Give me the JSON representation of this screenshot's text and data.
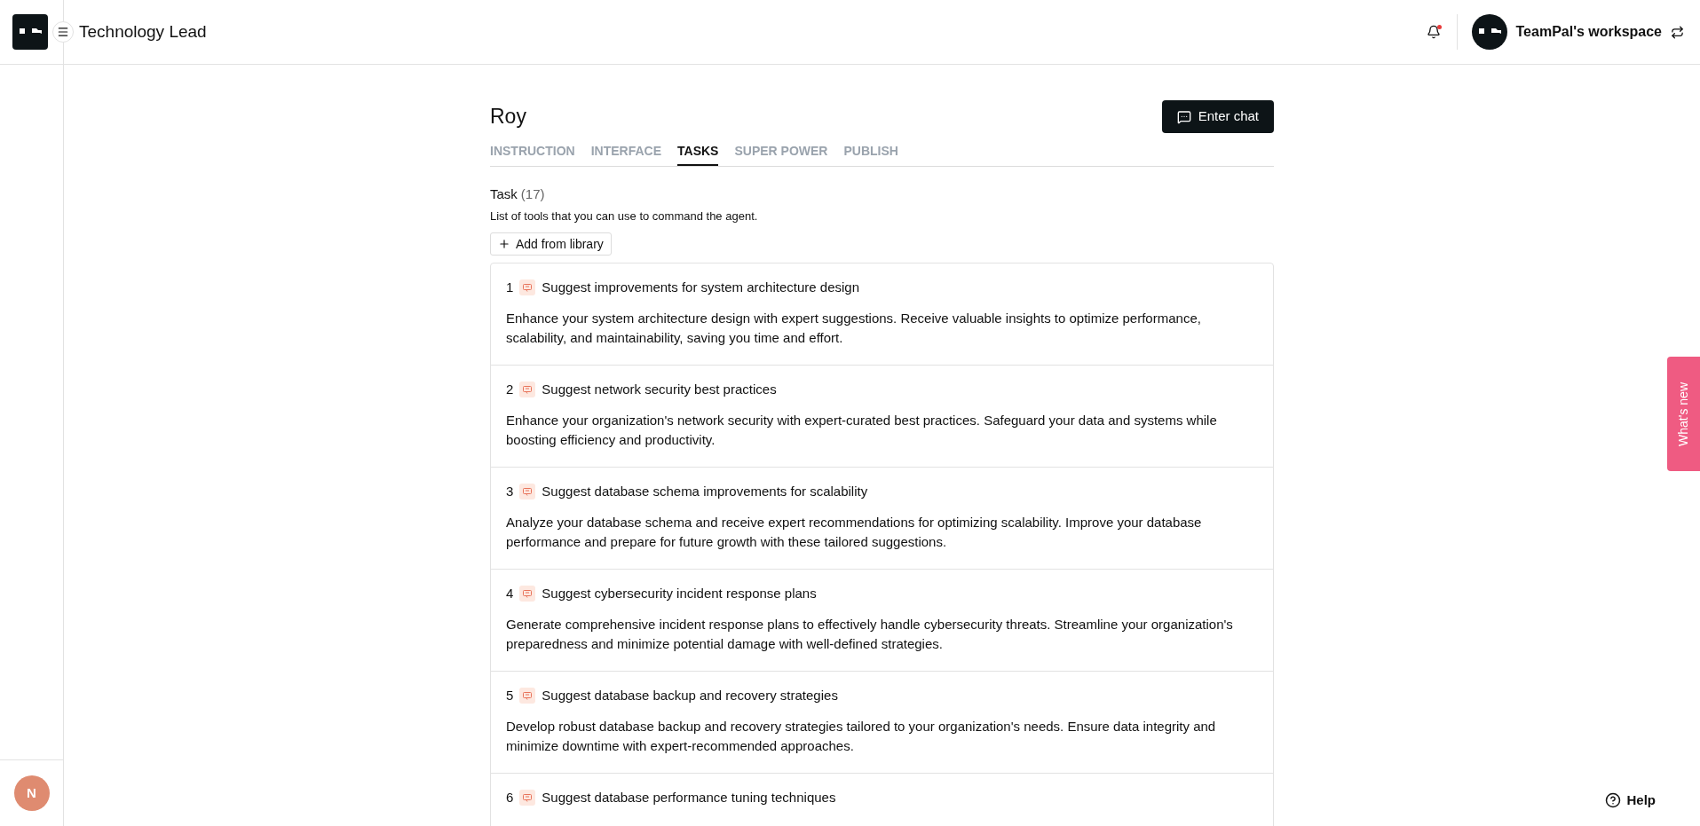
{
  "header": {
    "title": "Technology Lead",
    "workspace": "TeamPal's workspace",
    "notification_unread": true
  },
  "user_avatar": {
    "initial": "N"
  },
  "agent": {
    "name": "Roy",
    "enter_chat": "Enter chat"
  },
  "tabs": [
    {
      "label": "INSTRUCTION",
      "selected": false
    },
    {
      "label": "INTERFACE",
      "selected": false
    },
    {
      "label": "TASKS",
      "selected": true
    },
    {
      "label": "SUPER POWER",
      "selected": false
    },
    {
      "label": "PUBLISH",
      "selected": false
    }
  ],
  "tasks_section": {
    "title": "Task",
    "count": "(17)",
    "subtitle": "List of tools that you can use to command the agent.",
    "add_button": "Add from library"
  },
  "tasks": [
    {
      "number": "1",
      "title": "Suggest improvements for system architecture design",
      "description": "Enhance your system architecture design with expert suggestions. Receive valuable insights to optimize performance, scalability, and maintainability, saving you time and effort."
    },
    {
      "number": "2",
      "title": "Suggest network security best practices",
      "description": "Enhance your organization's network security with expert-curated best practices. Safeguard your data and systems while boosting efficiency and productivity."
    },
    {
      "number": "3",
      "title": "Suggest database schema improvements for scalability",
      "description": "Analyze your database schema and receive expert recommendations for optimizing scalability. Improve your database performance and prepare for future growth with these tailored suggestions."
    },
    {
      "number": "4",
      "title": "Suggest cybersecurity incident response plans",
      "description": "Generate comprehensive incident response plans to effectively handle cybersecurity threats. Streamline your organization's preparedness and minimize potential damage with well-defined strategies."
    },
    {
      "number": "5",
      "title": "Suggest database backup and recovery strategies",
      "description": "Develop robust database backup and recovery strategies tailored to your organization's needs. Ensure data integrity and minimize downtime with expert-recommended approaches."
    },
    {
      "number": "6",
      "title": "Suggest database performance tuning techniques"
    }
  ],
  "whats_new": "What's new",
  "help": "Help"
}
